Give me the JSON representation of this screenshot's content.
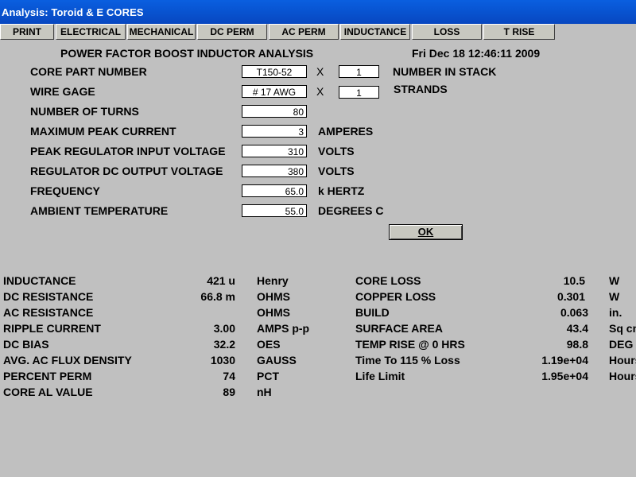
{
  "window": {
    "title": "Analysis: Toroid & E CORES"
  },
  "menu": [
    "PRINT",
    "ELECTRICAL",
    "MECHANICAL",
    "DC PERM",
    "AC PERM",
    "INDUCTANCE",
    "LOSS",
    "T RISE"
  ],
  "header": {
    "title": "POWER FACTOR BOOST INDUCTOR ANALYSIS",
    "timestamp": "Fri Dec 18 12:46:11 2009"
  },
  "form": {
    "core_part_number": {
      "label": "CORE PART NUMBER",
      "value": "T150-52",
      "x": "X",
      "multiplier": "1",
      "suffix": "NUMBER IN STACK"
    },
    "wire_gage": {
      "label": "WIRE GAGE",
      "value": "# 17 AWG",
      "x": "X",
      "multiplier": "1",
      "suffix": "STRANDS"
    },
    "turns": {
      "label": "NUMBER OF TURNS",
      "value": "80"
    },
    "peak_current": {
      "label": "MAXIMUM PEAK CURRENT",
      "value": "3",
      "unit": "AMPERES"
    },
    "peak_input_voltage": {
      "label": "PEAK REGULATOR INPUT VOLTAGE",
      "value": "310",
      "unit": "VOLTS"
    },
    "dc_output_voltage": {
      "label": "REGULATOR DC OUTPUT VOLTAGE",
      "value": "380",
      "unit": "VOLTS"
    },
    "frequency": {
      "label": "FREQUENCY",
      "value": "65.0",
      "unit": "k HERTZ"
    },
    "ambient_temp": {
      "label": "AMBIENT TEMPERATURE",
      "value": "55.0",
      "unit": "DEGREES C"
    },
    "ok": "OK"
  },
  "results_left": [
    {
      "label": "INDUCTANCE",
      "value": "421 u",
      "unit": "Henry"
    },
    {
      "label": "DC RESISTANCE",
      "value": "66.8 m",
      "unit": "OHMS"
    },
    {
      "label": "AC RESISTANCE",
      "value": "",
      "unit": "OHMS"
    },
    {
      "label": "RIPPLE CURRENT",
      "value": "3.00",
      "unit": "AMPS p-p"
    },
    {
      "label": "DC BIAS",
      "value": "32.2",
      "unit": "OES"
    },
    {
      "label": "AVG. AC FLUX DENSITY",
      "value": "1030",
      "unit": "GAUSS"
    },
    {
      "label": "PERCENT PERM",
      "value": "74",
      "unit": "PCT"
    },
    {
      "label": "CORE AL VALUE",
      "value": "89",
      "unit": "nH"
    }
  ],
  "results_right": [
    {
      "label": "CORE LOSS",
      "value": "10.5",
      "unit": "W"
    },
    {
      "label": "COPPER LOSS",
      "value": "0.301",
      "unit": "W"
    },
    {
      "label": "BUILD",
      "value": "0.063",
      "unit": "in."
    },
    {
      "label": "SURFACE AREA",
      "value": "43.4",
      "unit": "Sq cm"
    },
    {
      "label": "TEMP RISE @ 0 HRS",
      "value": "98.8",
      "unit": "DEG C"
    },
    {
      "label": "Time To 115 % Loss",
      "value": "1.19e+04",
      "unit": "Hours"
    },
    {
      "label": "Life Limit",
      "value": "1.95e+04",
      "unit": "Hours"
    }
  ]
}
